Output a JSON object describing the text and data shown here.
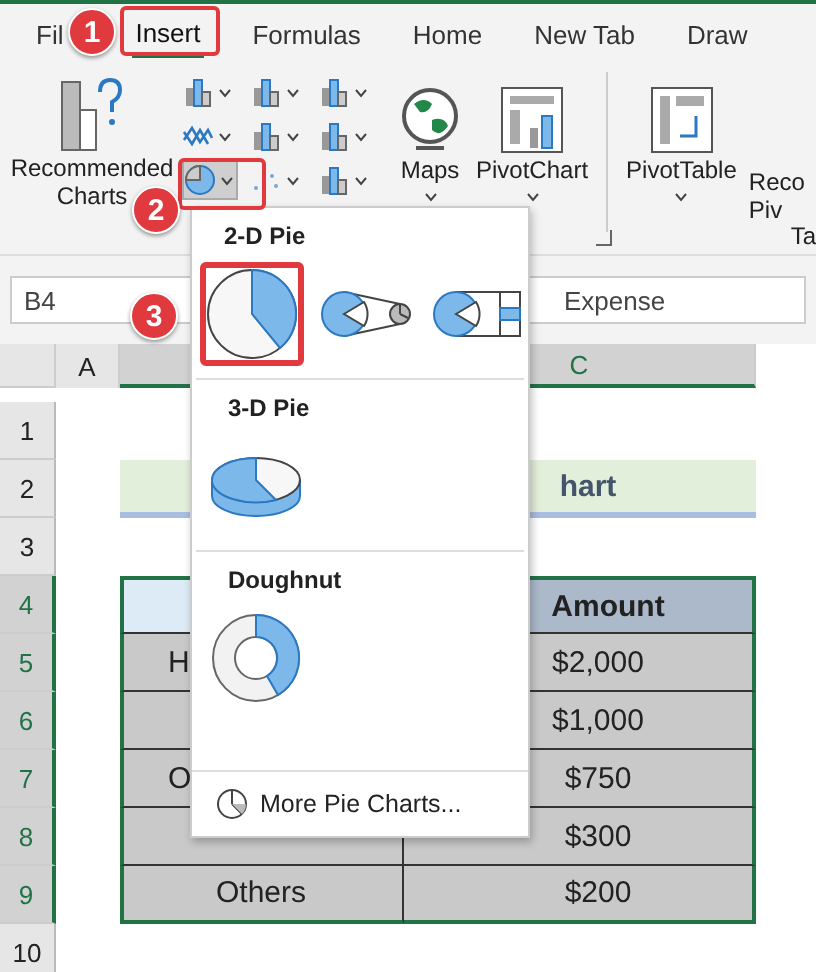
{
  "ribbon_tabs": [
    {
      "label": "Fil",
      "selected": false
    },
    {
      "label": "Insert",
      "selected": true
    },
    {
      "label": "Formulas",
      "selected": false
    },
    {
      "label": "Home",
      "selected": false
    },
    {
      "label": "New Tab",
      "selected": false
    },
    {
      "label": "Draw",
      "selected": false
    }
  ],
  "ribbon": {
    "recommended_charts": "Recommended Charts",
    "maps": "Maps",
    "pivot_chart": "PivotChart",
    "pivot_table": "PivotTable",
    "cut_button_line_1": "Reco",
    "cut_button_line_2": "Piv",
    "cut_group_label": "Ta"
  },
  "formula_bar": {
    "name_box": "B4",
    "formula": "Expense"
  },
  "column_headers": [
    "A",
    "C"
  ],
  "row_headers": [
    {
      "label": "1",
      "selected": false
    },
    {
      "label": "2",
      "selected": false
    },
    {
      "label": "3",
      "selected": false
    },
    {
      "label": "4",
      "selected": true
    },
    {
      "label": "5",
      "selected": true
    },
    {
      "label": "6",
      "selected": true
    },
    {
      "label": "7",
      "selected": true
    },
    {
      "label": "8",
      "selected": true
    },
    {
      "label": "9",
      "selected": true
    },
    {
      "label": "10",
      "selected": false
    }
  ],
  "sheet": {
    "title": "hart",
    "amount_header": "Amount",
    "rows": [
      {
        "label": "H",
        "amount": "$2,000"
      },
      {
        "amount": "$1,000"
      },
      {
        "label": "O",
        "amount": "$750"
      },
      {
        "amount": "$300"
      },
      {
        "label": "Others",
        "amount": "$200"
      }
    ]
  },
  "pie_menu": {
    "sections": [
      {
        "title": "2-D Pie",
        "items": [
          {
            "kind": "pie",
            "selected": true
          },
          {
            "kind": "pie-of-pie",
            "selected": false
          },
          {
            "kind": "bar-of-pie",
            "selected": false
          }
        ]
      },
      {
        "title": "3-D Pie",
        "items": [
          {
            "kind": "pie-3d",
            "selected": false
          }
        ]
      },
      {
        "title": "Doughnut",
        "items": [
          {
            "kind": "doughnut",
            "selected": false
          }
        ]
      }
    ],
    "more": "More Pie Charts..."
  },
  "step_badges": [
    "1",
    "2",
    "3"
  ]
}
